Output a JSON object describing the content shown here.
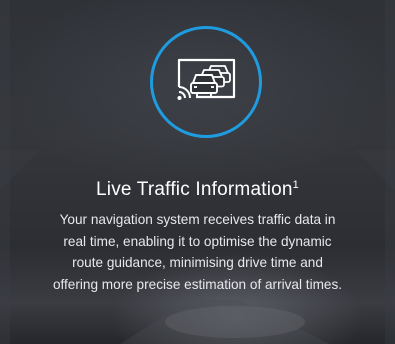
{
  "feature": {
    "icon": "live-traffic-icon",
    "title": "Live Traffic Information",
    "title_footnote": "1",
    "description_lines": [
      "Your navigation system receives traffic data in",
      "real time, enabling it to optimise the dynamic",
      "route guidance, minimising drive time and",
      "offering more precise estimation of arrival times."
    ]
  },
  "colors": {
    "accent": "#1f9be0",
    "background": "#2f3237",
    "text": "#ffffff"
  }
}
